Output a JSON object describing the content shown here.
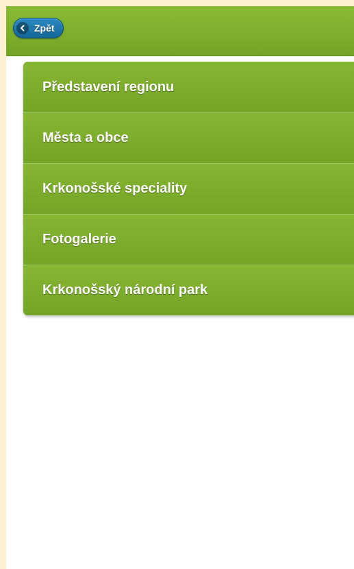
{
  "header": {
    "back_label": "Zpět",
    "back_icon": "chevron-left-icon"
  },
  "menu": {
    "items": [
      {
        "label": "Představení regionu"
      },
      {
        "label": "Města a obce"
      },
      {
        "label": "Krkonošské speciality"
      },
      {
        "label": "Fotogalerie"
      },
      {
        "label": "Krkonošský národní park"
      }
    ]
  },
  "colors": {
    "header_green": "#7cb12d",
    "back_button_blue": "#1a76ad",
    "menu_green": "#78aa28",
    "page_border": "#fdf0d2"
  }
}
